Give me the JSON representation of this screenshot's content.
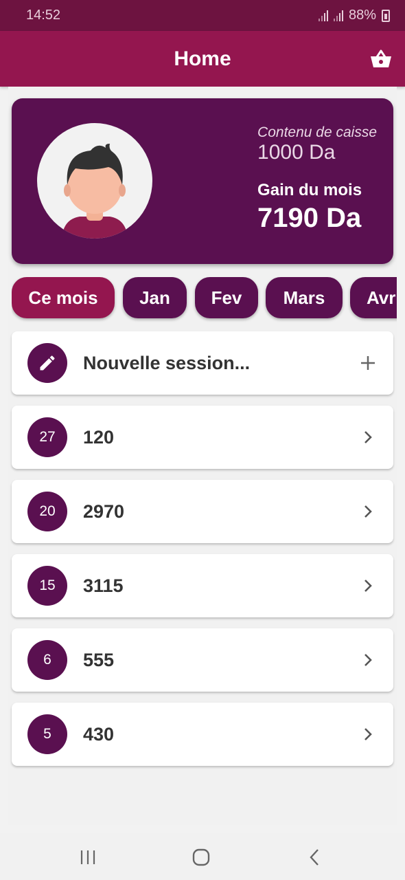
{
  "status_bar": {
    "time": "14:52",
    "battery": "88%"
  },
  "app_bar": {
    "title": "Home",
    "cart_icon": "shopping-basket-icon"
  },
  "profile": {
    "caisse_label": "Contenu de caisse",
    "caisse_value": "1000 Da",
    "gain_label": "Gain du mois",
    "gain_value": "7190 Da"
  },
  "months": [
    {
      "label": "Ce mois",
      "active": true
    },
    {
      "label": "Jan",
      "active": false
    },
    {
      "label": "Fev",
      "active": false
    },
    {
      "label": "Mars",
      "active": false
    },
    {
      "label": "Avr",
      "active": false
    }
  ],
  "new_session": {
    "label": "Nouvelle session...",
    "icon": "pencil-icon",
    "action_icon": "plus-icon"
  },
  "sessions": [
    {
      "day": "27",
      "amount": "120"
    },
    {
      "day": "20",
      "amount": "2970"
    },
    {
      "day": "15",
      "amount": "3115"
    },
    {
      "day": "6",
      "amount": "555"
    },
    {
      "day": "5",
      "amount": "430"
    }
  ],
  "colors": {
    "status_bar": "#6d1340",
    "app_bar": "#94164f",
    "primary_dark": "#5a1050",
    "accent": "#94164f"
  }
}
